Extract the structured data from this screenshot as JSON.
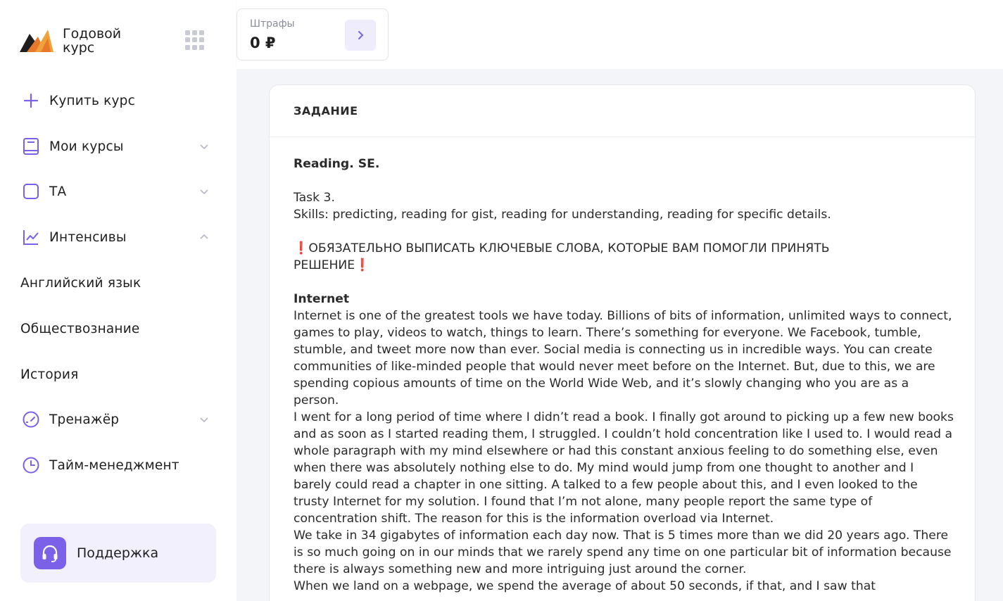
{
  "brand": {
    "line1": "Годовой",
    "line2": "курс"
  },
  "sidebar": {
    "items": [
      {
        "label": "Купить курс",
        "icon": "plus-icon"
      },
      {
        "label": "Мои курсы",
        "icon": "book-icon",
        "chevron": "down"
      },
      {
        "label": "ТА",
        "icon": "square-icon",
        "chevron": "down"
      },
      {
        "label": "Интенсивы",
        "icon": "chart-line-icon",
        "chevron": "up"
      },
      {
        "label": "Английский язык"
      },
      {
        "label": "Обществознание"
      },
      {
        "label": "История"
      },
      {
        "label": "Тренажёр",
        "icon": "gauge-icon",
        "chevron": "down"
      },
      {
        "label": "Тайм-менеджмент",
        "icon": "clock-icon"
      }
    ],
    "support": "Поддержка"
  },
  "fines": {
    "label": "Штрафы",
    "value": "0 ₽"
  },
  "task": {
    "header": "ЗАДАНИЕ",
    "title": "Reading. SE.",
    "task_no": "Task 3.",
    "skills": "Skills: predicting, reading for gist, reading for understanding, reading for specific details.",
    "notice_line1": "ОБЯЗАТЕЛЬНО ВЫПИСАТЬ КЛЮЧЕВЫЕ СЛОВА, КОТОРЫЕ ВАМ ПОМОГЛИ ПРИНЯТЬ",
    "notice_line2": "РЕШЕНИЕ",
    "excl": "❗",
    "section_title": "Internet",
    "p1": "Internet is one of the greatest tools we have today. Billions of bits of information, unlimited ways to connect, games to play, videos to watch, things to learn. There’s something for everyone. We Facebook, tumble, stumble, and tweet more now than ever. Social media is connecting us in incredible ways. You can create communities of like-minded people that would never meet before on the Internet. But, due to this, we are spending copious amounts of time on the World Wide Web, and it’s slowly changing who you are as a person.",
    "p2": "I went for a long period of time where I didn’t read a book. I finally got around to picking up a few new books and as soon as I started reading them, I struggled. I couldn’t hold concentration like I used to. I would read a whole paragraph with my mind elsewhere or had this constant anxious feeling to do something else, even when there was absolutely nothing else to do. My mind would jump from one thought to another and I barely could read a chapter in one sitting. A talked to a few people about this, and I even looked to the trusty Internet for my solution. I found that I’m not alone, many people report the same type of concentration shift. The reason for this is the information overload via Internet.",
    "p3": "We take in 34 gigabytes of information each day now. That is 5 times more than we did 20 years ago. There is so much going on in our minds that we rarely spend any time on one particular bit of information because there is always something new and more intriguing just around the corner.",
    "p4": "When we land on a webpage, we spend the average of about 50 seconds, if that, and I saw that"
  },
  "colors": {
    "accent": "#7b61e8",
    "accent_light": "#f2f0fd",
    "logo_orange": "#e8792b",
    "logo_dark": "#1e1e1e"
  }
}
